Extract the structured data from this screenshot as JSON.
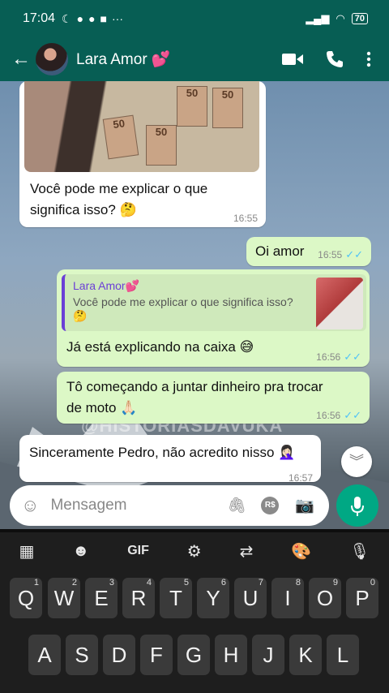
{
  "status_bar": {
    "time": "17:04",
    "battery": "70"
  },
  "header": {
    "contact_name": "Lara Amor 💕",
    "icons": [
      "back-arrow-icon",
      "video-call-icon",
      "phone-icon",
      "more-icon"
    ]
  },
  "messages": [
    {
      "type": "in",
      "text": "Você pode me explicar o que significa isso? 🤔",
      "time": "16:55",
      "image_notes": [
        "50",
        "50",
        "50",
        "50"
      ]
    },
    {
      "type": "out",
      "text": "Oi amor",
      "time": "16:55"
    },
    {
      "type": "out",
      "reply_to_name": "Lara Amor💕",
      "reply_to_text": "Você pode me explicar o que significa isso? 🤔",
      "text": "Já está explicando na caixa 😅",
      "time": "16:56"
    },
    {
      "type": "out",
      "text": "Tô começando a juntar dinheiro pra trocar de moto 🙏🏻",
      "time": "16:56"
    },
    {
      "type": "in",
      "text": "Sinceramente Pedro, não acredito nisso 🤦🏻‍♀️",
      "time": "16:57"
    }
  ],
  "watermark": "@HISTORIASDAVUKA",
  "input": {
    "placeholder": "Mensagem",
    "currency_label": "R$"
  },
  "keyboard": {
    "toolbar": [
      "grid-icon",
      "sticker-icon",
      "GIF",
      "gear-icon",
      "translate-icon",
      "palette-icon",
      "mic-icon"
    ],
    "gif_label": "GIF",
    "row1": [
      "Q",
      "W",
      "E",
      "R",
      "T",
      "Y",
      "U",
      "I",
      "O",
      "P"
    ],
    "row1_hints": [
      "1",
      "2",
      "3",
      "4",
      "5",
      "6",
      "7",
      "8",
      "9",
      "0"
    ],
    "row2": [
      "A",
      "S",
      "D",
      "F",
      "G",
      "H",
      "J",
      "K",
      "L"
    ]
  },
  "colors": {
    "header": "#075e54",
    "outgoing": "#dcf8c6",
    "incoming": "#ffffff",
    "accent": "#00a884",
    "ticks": "#4fc3f7"
  }
}
